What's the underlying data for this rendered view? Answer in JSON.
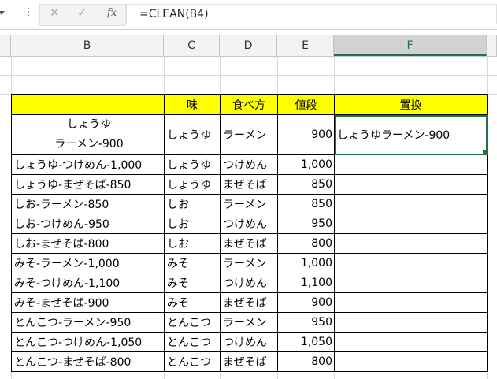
{
  "formula_bar": {
    "formula": "=CLEAN(B4)",
    "cancel_icon": "x-icon",
    "enter_icon": "check-icon",
    "fx_label": "fx"
  },
  "columns": [
    "B",
    "C",
    "D",
    "E",
    "F"
  ],
  "selected_column": "F",
  "table": {
    "headers": [
      "",
      "味",
      "食べ方",
      "値段",
      "置換"
    ],
    "row1": {
      "b_line1": "しょうゆ",
      "b_line2": "ラーメン-900",
      "c": "しょうゆ",
      "d": "ラーメン",
      "e": "900",
      "f": "しょうゆラーメン-900"
    },
    "rows": [
      [
        "しょうゆ-つけめん-1,000",
        "しょうゆ",
        "つけめん",
        "1,000",
        ""
      ],
      [
        "しょうゆ-まぜそば-850",
        "しょうゆ",
        "まぜそば",
        "850",
        ""
      ],
      [
        "しお-ラーメン-850",
        "しお",
        "ラーメン",
        "850",
        ""
      ],
      [
        "しお-つけめん-950",
        "しお",
        "つけめん",
        "950",
        ""
      ],
      [
        "しお-まぜそば-800",
        "しお",
        "まぜそば",
        "800",
        ""
      ],
      [
        "みそ-ラーメン-1,000",
        "みそ",
        "ラーメン",
        "1,000",
        ""
      ],
      [
        "みそ-つけめん-1,100",
        "みそ",
        "つけめん",
        "1,100",
        ""
      ],
      [
        "みそ-まぜそば-900",
        "みそ",
        "まぜそば",
        "900",
        ""
      ],
      [
        "とんこつ-ラーメン-950",
        "とんこつ",
        "ラーメン",
        "950",
        ""
      ],
      [
        "とんこつ-つけめん-1,050",
        "とんこつ",
        "つけめん",
        "1,050",
        ""
      ],
      [
        "とんこつ-まぜそば-800",
        "とんこつ",
        "まぜそば",
        "800",
        ""
      ]
    ]
  },
  "colors": {
    "accent": "#217346",
    "header_fill": "#ffff00"
  }
}
